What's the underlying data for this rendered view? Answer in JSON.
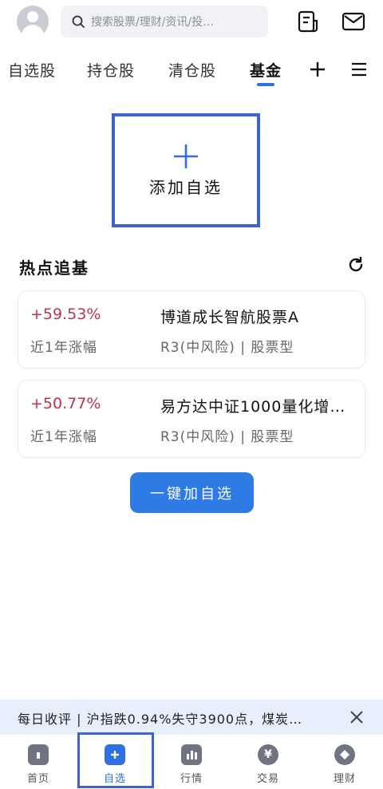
{
  "header": {
    "search_placeholder": "搜索股票/理财/资讯/投…"
  },
  "tabs": [
    {
      "label": "自选股"
    },
    {
      "label": "持仓股"
    },
    {
      "label": "清仓股"
    },
    {
      "label": "基金"
    }
  ],
  "add_watch": {
    "label": "添加自选"
  },
  "hot": {
    "title": "热点追基",
    "funds": [
      {
        "change": "+59.53%",
        "change_label": "近1年涨幅",
        "name": "博道成长智航股票A",
        "meta": "R3(中风险) | 股票型"
      },
      {
        "change": "+50.77%",
        "change_label": "近1年涨幅",
        "name": "易方达中证1000量化增…",
        "meta": "R3(中风险) | 股票型"
      }
    ]
  },
  "one_click_label": "一键加自选",
  "ticker": {
    "text": "每日收评 | 沪指跌0.94%失守3900点，煤炭…"
  },
  "nav": [
    {
      "label": "首页",
      "icon": "home-icon"
    },
    {
      "label": "自选",
      "icon": "plus-square-icon"
    },
    {
      "label": "行情",
      "icon": "bar-chart-icon"
    },
    {
      "label": "交易",
      "icon": "yen-coin-icon"
    },
    {
      "label": "理财",
      "icon": "diamond-icon"
    }
  ],
  "colors": {
    "accent": "#2f6fe4",
    "gain": "#c0334d",
    "highlight": "#3f62d2"
  }
}
